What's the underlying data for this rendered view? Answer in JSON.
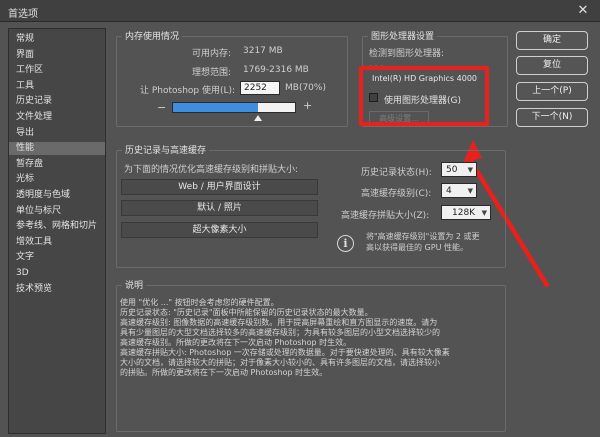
{
  "window": {
    "title": "首选项",
    "close": "✕"
  },
  "sidebar": {
    "items": [
      {
        "label": "常规"
      },
      {
        "label": "界面"
      },
      {
        "label": "工作区"
      },
      {
        "label": "工具"
      },
      {
        "label": "历史记录"
      },
      {
        "label": "文件处理"
      },
      {
        "label": "导出"
      },
      {
        "label": "性能"
      },
      {
        "label": "暂存盘"
      },
      {
        "label": "光标"
      },
      {
        "label": "透明度与色域"
      },
      {
        "label": "单位与标尺"
      },
      {
        "label": "参考线、网格和切片"
      },
      {
        "label": "增效工具"
      },
      {
        "label": "文字"
      },
      {
        "label": "3D"
      },
      {
        "label": "技术预览"
      }
    ],
    "selected_index": 7
  },
  "memory": {
    "title": "内存使用情况",
    "available_label": "可用内存:",
    "available_value": "3217 MB",
    "ideal_label": "理想范围:",
    "ideal_value": "1769-2316 MB",
    "let_label": "让 Photoshop 使用(L):",
    "let_value": "2252",
    "mb_pct": "MB(70%)",
    "minus": "−",
    "plus": "+",
    "slider_fraction": 0.7
  },
  "gpu": {
    "title": "图形处理器设置",
    "detected_label": "检测到图形处理器:",
    "gpu_name": "Intel(R) HD Graphics 4000",
    "use_gpu_label": "使用图形处理器(G)",
    "use_gpu_checked": false,
    "advanced_label": "高级设置..."
  },
  "history": {
    "title": "历史记录与高速缓存",
    "optimize_label": "为下面的情况优化高速缓存级别和拼贴大小:",
    "buttons": [
      "Web / 用户界面设计",
      "默认 / 照片",
      "超大像素大小"
    ],
    "states_label": "历史记录状态(H):",
    "states_value": "50",
    "levels_label": "高速缓存级别(C):",
    "levels_value": "4",
    "tile_label": "高速缓存拼贴大小(Z):",
    "tile_value": "128K",
    "info_icon": "i",
    "tip_line1": "将\"高速缓存级别\"设置为 2 或更",
    "tip_line2": "高以获得最佳的 GPU 性能。"
  },
  "description": {
    "title": "说明",
    "lines": [
      "使用 \"优化 ...\" 按钮时会考虑您的硬件配置。",
      "历史记录状态: \"历史记录\"面板中所能保留的历史记录状态的最大数量。",
      "高速缓存级别: 图像数据的高速缓存级别数。用于提高屏幕重绘和直方图显示的速度。请为",
      "具有少量图层的大型文档选择较多的高速缓存级别；为具有较多图层的小型文档选择较少的",
      "高速缓存级别。所做的更改将在下一次启动 Photoshop 时生效。",
      "高速缓存拼贴大小: Photoshop 一次存储或处理的数据量。对于要快速处理的、具有较大像素",
      "大小的文档，请选择较大的拼贴；对于像素大小较小的、具有许多图层的文档，请选择较小",
      "的拼贴。所做的更改将在下一次启动 Photoshop 时生效。"
    ]
  },
  "right_buttons": {
    "ok": "确定",
    "reset": "复位",
    "prev": "上一个(P)",
    "next": "下一个(N)"
  },
  "colors": {
    "annotation_red": "#e8211d",
    "dialog_bg": "#535353",
    "slider_blue": "#3d8de0"
  }
}
